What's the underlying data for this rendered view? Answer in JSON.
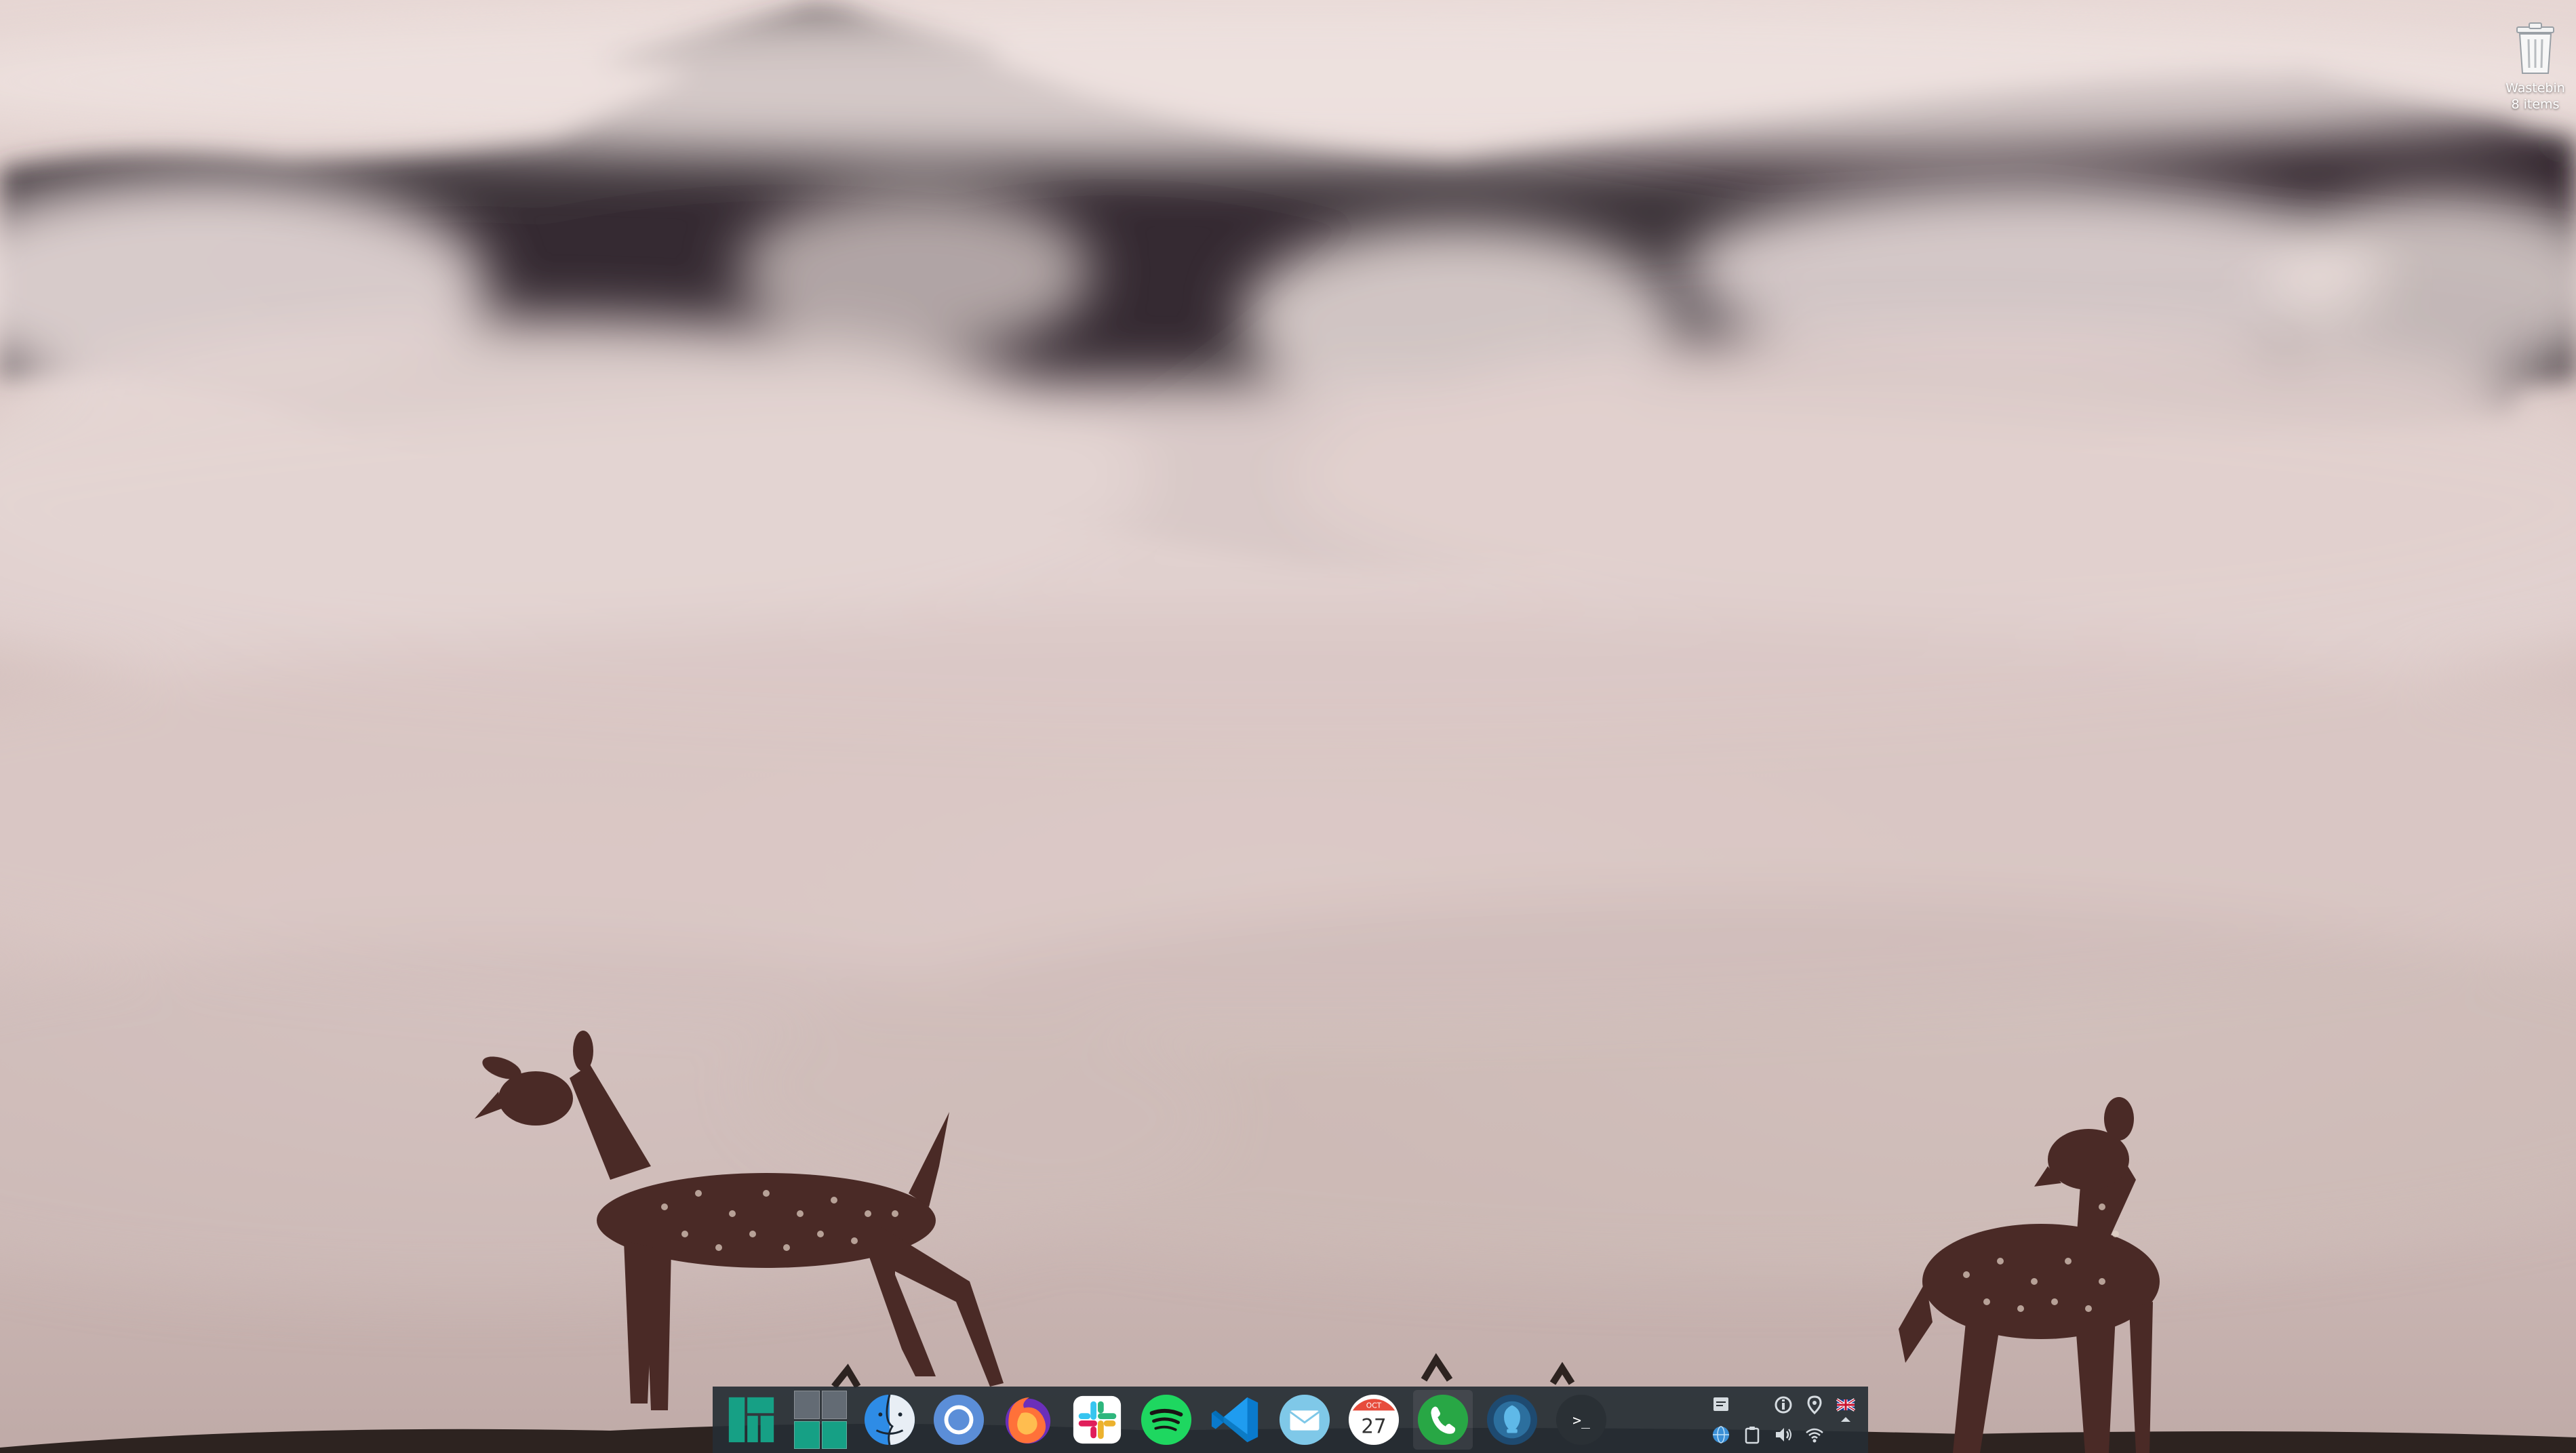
{
  "desktop": {
    "icons": [
      {
        "label": "Wastebin",
        "sublabel": "8 items",
        "icon": "trash-icon"
      }
    ]
  },
  "dock": {
    "items": [
      {
        "name": "manjaro-menu",
        "icon": "manjaro-logo-icon"
      },
      {
        "name": "workspace-switcher",
        "icon": "workspace-grid-icon"
      },
      {
        "name": "finder",
        "icon": "finder-face-icon"
      },
      {
        "name": "chromium",
        "icon": "chromium-icon"
      },
      {
        "name": "firefox",
        "icon": "firefox-icon"
      },
      {
        "name": "slack",
        "icon": "slack-icon"
      },
      {
        "name": "spotify",
        "icon": "spotify-icon"
      },
      {
        "name": "vscode",
        "icon": "vscode-icon"
      },
      {
        "name": "mail",
        "icon": "mail-icon"
      },
      {
        "name": "calendar",
        "icon": "calendar-icon",
        "month": "OCT",
        "day": "27"
      },
      {
        "name": "whatsapp",
        "icon": "phone-icon",
        "active": true
      },
      {
        "name": "mycroft",
        "icon": "assistant-icon"
      },
      {
        "name": "terminal",
        "icon": "terminal-icon",
        "prompt": ">_"
      }
    ],
    "tray": [
      "notes-icon",
      "",
      "info-icon",
      "location-pin-icon",
      "uk-flag-icon",
      "",
      "globe-icon",
      "clipboard-icon",
      "volume-icon",
      "wifi-icon",
      "chevron-up-icon"
    ]
  },
  "colors": {
    "dock_bg": "#262e34",
    "accent": "#16a085"
  }
}
